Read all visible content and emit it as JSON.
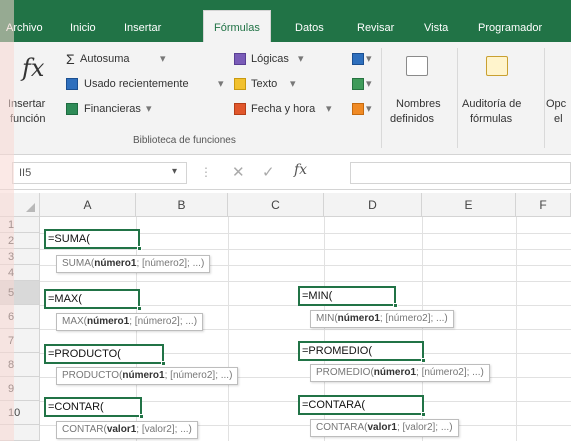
{
  "tabs": [
    "Archivo",
    "Inicio",
    "Insertar",
    "Fórmulas",
    "Datos",
    "Revisar",
    "Vista",
    "Programador"
  ],
  "active_tab": "Fórmulas",
  "ribbon": {
    "insert_function": {
      "line1": "Insertar",
      "line2": "función",
      "symbol": "fx"
    },
    "autosum": "Autosuma",
    "recent": "Usado recientemente",
    "financial": "Financieras",
    "logical": "Lógicas",
    "text": "Texto",
    "datetime": "Fecha y hora",
    "group_label": "Biblioteca de funciones",
    "names": {
      "line1": "Nombres",
      "line2": "definidos"
    },
    "audit": {
      "line1": "Auditoría de",
      "line2": "fórmulas"
    },
    "options": {
      "line1": "Opc",
      "line2": "el"
    }
  },
  "formula_bar": {
    "name_box": "II5",
    "fx_label": "fx"
  },
  "columns": [
    "A",
    "B",
    "C",
    "D",
    "E",
    "F"
  ],
  "rows": [
    "1",
    "2",
    "3",
    "4",
    "5",
    "6",
    "7",
    "8",
    "9",
    "10"
  ],
  "cells": {
    "suma": "=SUMA(",
    "max": "=MAX(",
    "min": "=MIN(",
    "producto": "=PRODUCTO(",
    "promedio": "=PROMEDIO(",
    "contar": "=CONTAR(",
    "contara": "=CONTARA("
  },
  "tooltips": {
    "suma": {
      "fn": "SUMA(",
      "arg": "número1",
      "rest": "; [número2]; ...)"
    },
    "max": {
      "fn": "MAX(",
      "arg": "número1",
      "rest": "; [número2]; ...)"
    },
    "min": {
      "fn": "MIN(",
      "arg": "número1",
      "rest": "; [número2]; ...)"
    },
    "producto": {
      "fn": "PRODUCTO(",
      "arg": "número1",
      "rest": "; [número2]; ...)"
    },
    "promedio": {
      "fn": "PROMEDIO(",
      "arg": "número1",
      "rest": "; [número2]; ...)"
    },
    "contar": {
      "fn": "CONTAR(",
      "arg": "valor1",
      "rest": "; [valor2]; ...)"
    },
    "contara": {
      "fn": "CONTARA(",
      "arg": "valor1",
      "rest": "; [valor2]; ...)"
    }
  },
  "colors": {
    "brand_green": "#217346",
    "ribbon_bg": "#f3f3f3"
  }
}
